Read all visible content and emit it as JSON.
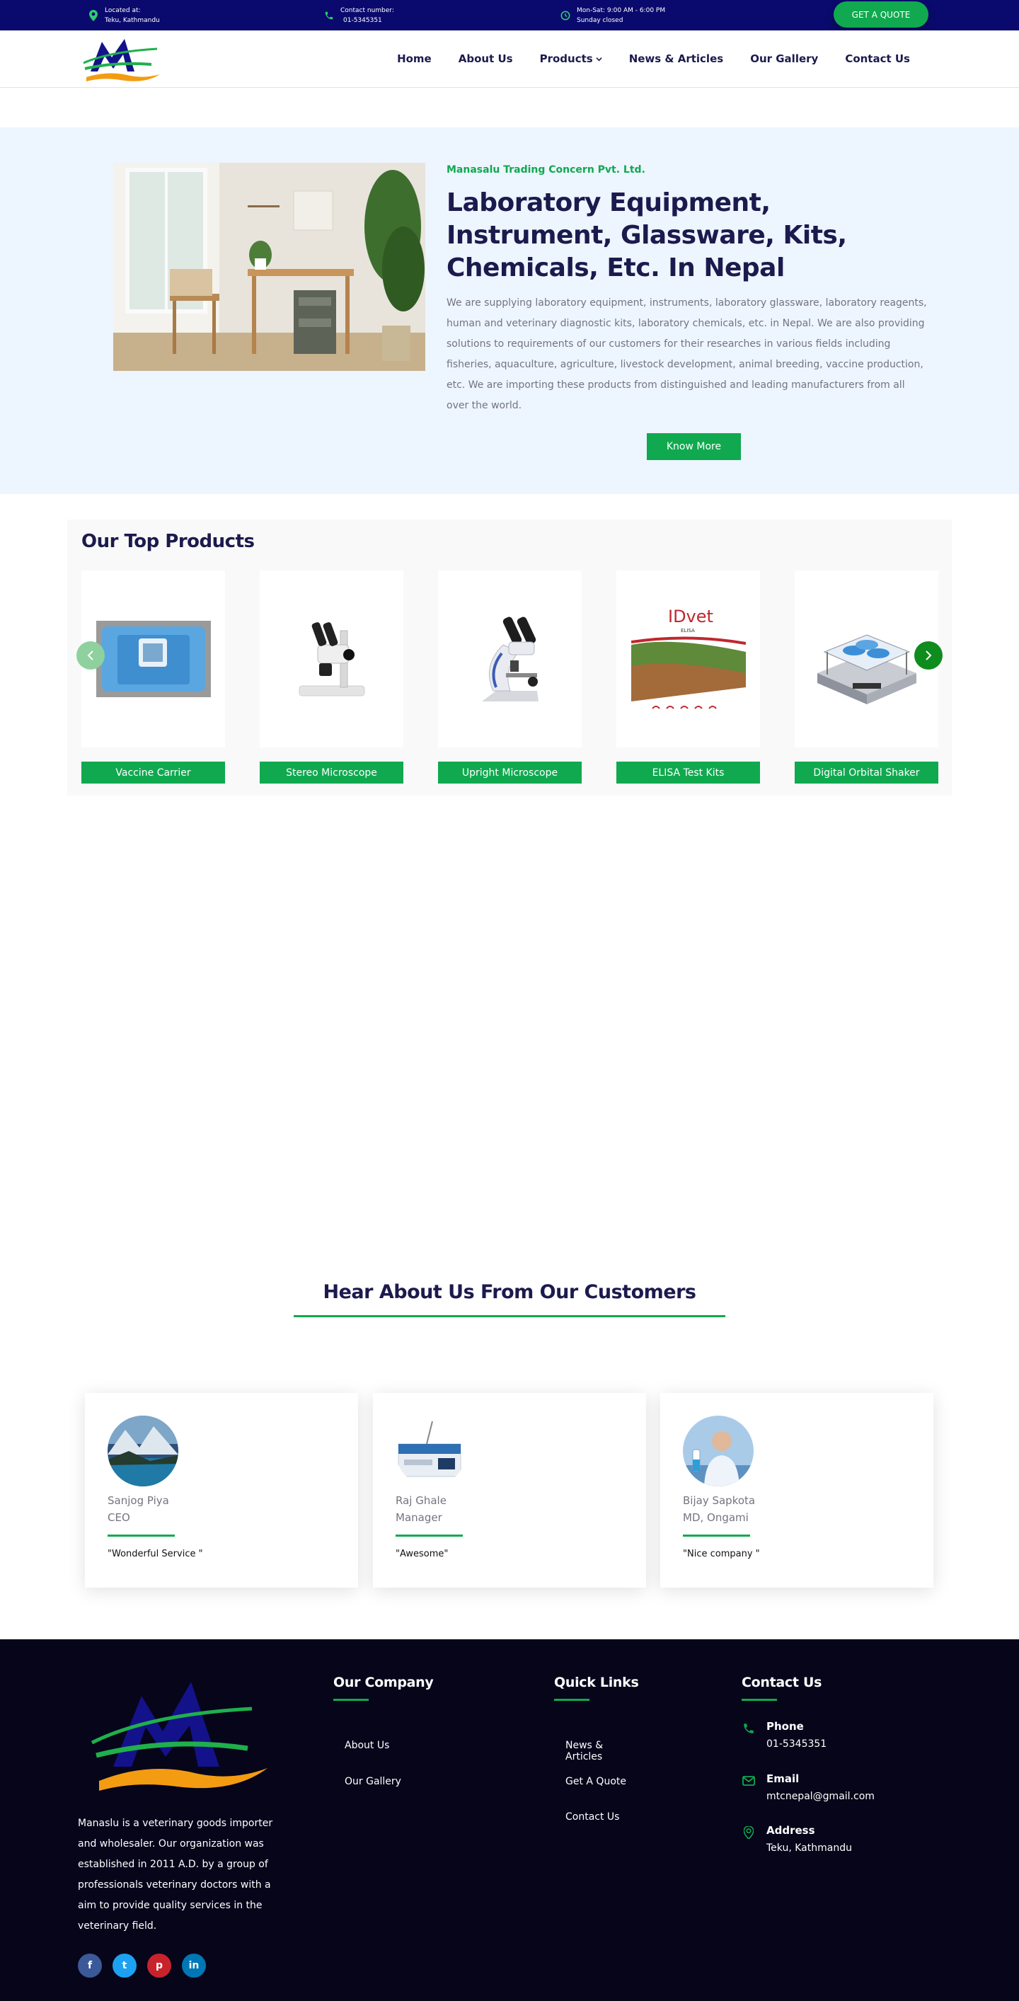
{
  "topbar": {
    "location_label": "Located at:",
    "location_value": "Teku, Kathmandu",
    "contact_label": "Contact number:",
    "contact_value": "01-5345351",
    "hours_line1": "Mon-Sat: 9:00 AM - 6:00 PM",
    "hours_line2": "Sunday closed",
    "quote_button": "GET A QUOTE"
  },
  "nav": {
    "items": [
      {
        "label": "Home"
      },
      {
        "label": "About Us"
      },
      {
        "label": "Products"
      },
      {
        "label": "News & Articles"
      },
      {
        "label": "Our Gallery"
      },
      {
        "label": "Contact Us"
      }
    ]
  },
  "hero": {
    "brand": "Manasalu Trading Concern Pvt. Ltd.",
    "title": "Laboratory Equipment, Instrument, Glassware, Kits, Chemicals, Etc. In Nepal",
    "description": "We are supplying laboratory equipment, instruments, laboratory glassware, laboratory reagents, human and veterinary diagnostic kits, laboratory chemicals, etc. in Nepal. We are also providing solutions to requirements of our customers for their researches in various fields including fisheries, aquaculture, agriculture, livestock development, animal breeding, vaccine production, etc. We are importing these products from distinguished and leading manufacturers from all over the world.",
    "button": "Know More"
  },
  "products": {
    "title": "Our Top Products",
    "items": [
      {
        "label": "Vaccine Carrier"
      },
      {
        "label": "Stereo Microscope"
      },
      {
        "label": "Upright Microscope"
      },
      {
        "label": "ELISA Test Kits"
      },
      {
        "label": "Digital Orbital Shaker"
      }
    ],
    "elisa_brand": "IDvet",
    "elisa_sub": "ELISA"
  },
  "testimonials": {
    "title": "Hear About Us From Our Customers",
    "items": [
      {
        "name": "Sanjog Piya",
        "role": "CEO",
        "quote": "\"Wonderful Service \""
      },
      {
        "name": "Raj Ghale",
        "role": "Manager",
        "quote": "\"Awesome\""
      },
      {
        "name": "Bijay Sapkota",
        "role": "MD, Ongami",
        "quote": "\"Nice company \""
      }
    ]
  },
  "footer": {
    "about": "Manaslu is a veterinary goods importer and wholesaler. Our organization was established in 2011 A.D. by a group of professionals veterinary doctors with a aim to provide quality services in the veterinary field.",
    "company_title": "Our Company",
    "company_links": [
      {
        "label": "About Us"
      },
      {
        "label": "Our Gallery"
      }
    ],
    "quick_title": "Quick Links",
    "quick_links": [
      {
        "label": "News & Articles"
      },
      {
        "label": "Get A Quote"
      },
      {
        "label": "Contact Us"
      }
    ],
    "contact_title": "Contact Us",
    "phone_title": "Phone",
    "phone_value": "01-5345351",
    "email_title": "Email",
    "email_value": "mtcnepal@gmail.com",
    "address_title": "Address",
    "address_value": "Teku, Kathmandu",
    "social": [
      {
        "icon": "facebook-icon",
        "glyph": "f",
        "color": "#3b5998"
      },
      {
        "icon": "twitter-icon",
        "glyph": "t",
        "color": "#1da1f2"
      },
      {
        "icon": "pinterest-icon",
        "glyph": "p",
        "color": "#c8232c"
      },
      {
        "icon": "linkedin-icon",
        "glyph": "in",
        "color": "#0077b5"
      }
    ]
  },
  "colors": {
    "primary_green": "#10a94f",
    "navy": "#0a0a6e",
    "heading": "#1c1a4d",
    "hero_bg": "#edf5ff",
    "footer_bg": "#07051a"
  }
}
